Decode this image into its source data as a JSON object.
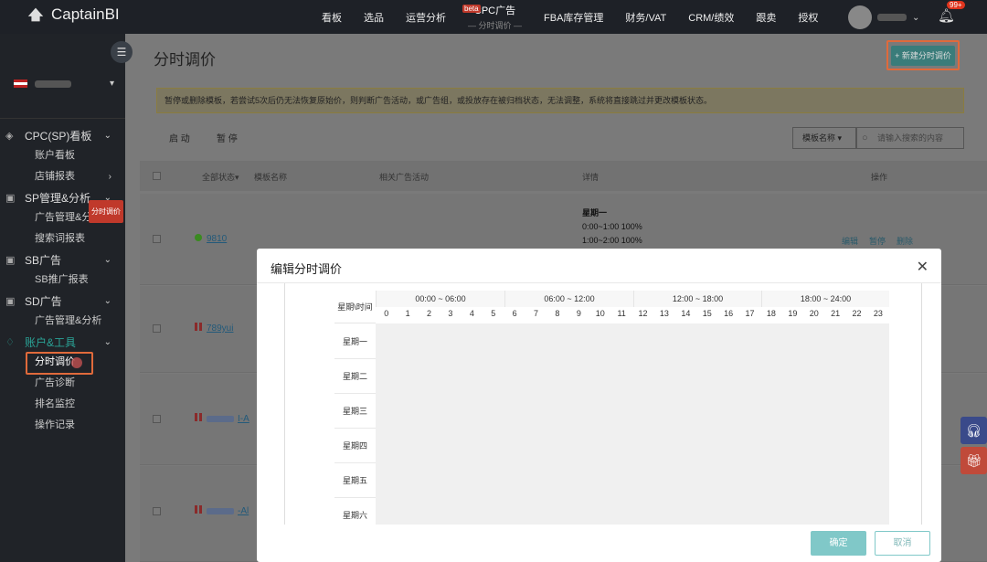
{
  "header": {
    "app_name": "CaptainBI",
    "nav": [
      "看板",
      "选品",
      "运营分析",
      "CPC广告",
      "FBA库存管理",
      "财务/VAT",
      "CRM/绩效",
      "跟卖",
      "授权"
    ],
    "beta_label": "beta",
    "nav_active_sub": "— 分时调价 —",
    "notification_count": "99+"
  },
  "sidebar": {
    "groups": [
      {
        "label": "CPC(SP)看板",
        "items": [
          "账户看板",
          "店铺报表"
        ]
      },
      {
        "label": "SP管理&分析",
        "items": [
          "广告管理&分析",
          "搜索词报表"
        ]
      },
      {
        "label": "SB广告",
        "items": [
          "SB推广报表"
        ]
      },
      {
        "label": "SD广告",
        "items": [
          "广告管理&分析"
        ]
      },
      {
        "label": "账户&工具",
        "items": [
          "分时调价",
          "广告诊断",
          "排名监控",
          "操作记录"
        ]
      }
    ],
    "tooltip": "分时调价"
  },
  "main": {
    "title": "分时调价",
    "new_button": "+ 新建分时调价",
    "notice": "暂停或删除模板，若尝试5次后仍无法恢复原始价，则判断广告活动，或广告组，或投放存在被归档状态，无法调整，系统将直接跳过并更改模板状态。",
    "start_btn": "启 动",
    "pause_btn": "暂 停",
    "template_select": "模板名称",
    "search_placeholder": "请输入搜索的内容",
    "columns": {
      "status": "全部状态▾",
      "name": "模板名称",
      "campaign": "相关广告活动",
      "detail": "详情",
      "ops": "操作"
    },
    "rows": [
      {
        "name": "9810",
        "detail_day": "星期一",
        "detail_1": "0:00~1:00      100%",
        "detail_2": "1:00~2:00      100%",
        "op_edit": "编辑",
        "op_pause": "暂停",
        "op_delete": "删除"
      },
      {
        "name": "789yui"
      },
      {
        "name": "I-A"
      },
      {
        "name": "-Al"
      }
    ]
  },
  "modal": {
    "title": "编辑分时调价",
    "corner": "星期\\时间",
    "segments": [
      "00:00 ~ 06:00",
      "06:00 ~ 12:00",
      "12:00 ~ 18:00",
      "18:00 ~ 24:00"
    ],
    "hours": [
      "0",
      "1",
      "2",
      "3",
      "4",
      "5",
      "6",
      "7",
      "8",
      "9",
      "10",
      "11",
      "12",
      "13",
      "14",
      "15",
      "16",
      "17",
      "18",
      "19",
      "20",
      "21",
      "22",
      "23"
    ],
    "days": [
      "星期一",
      "星期二",
      "星期三",
      "星期四",
      "星期五",
      "星期六"
    ],
    "ok": "确定",
    "cancel": "取消"
  },
  "colors": {
    "accent": "#2aa396",
    "highlight": "#e06a3b",
    "sidebar": "#202328",
    "topbar": "#1e2127"
  }
}
